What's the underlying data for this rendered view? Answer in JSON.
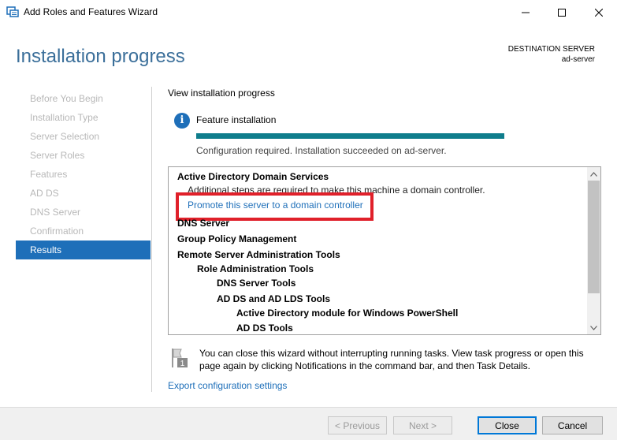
{
  "window": {
    "title": "Add Roles and Features Wizard",
    "icon": "server-manager-icon"
  },
  "header": {
    "page_title": "Installation progress",
    "destination_label": "DESTINATION SERVER",
    "destination_server": "ad-server"
  },
  "nav": {
    "items": [
      {
        "label": "Before You Begin",
        "active": false
      },
      {
        "label": "Installation Type",
        "active": false
      },
      {
        "label": "Server Selection",
        "active": false
      },
      {
        "label": "Server Roles",
        "active": false
      },
      {
        "label": "Features",
        "active": false
      },
      {
        "label": "AD DS",
        "active": false
      },
      {
        "label": "DNS Server",
        "active": false
      },
      {
        "label": "Confirmation",
        "active": false
      },
      {
        "label": "Results",
        "active": true
      }
    ]
  },
  "main": {
    "view_label": "View installation progress",
    "feature_label": "Feature installation",
    "progress": 1.0,
    "status_text": "Configuration required. Installation succeeded on ad-server.",
    "results": {
      "ad_ds_title": "Active Directory Domain Services",
      "ad_ds_note": "Additional steps are required to make this machine a domain controller.",
      "promote_link": "Promote this server to a domain controller",
      "dns_server": "DNS Server",
      "group_policy": "Group Policy Management",
      "rsat": "Remote Server Administration Tools",
      "role_admin_tools": "Role Administration Tools",
      "dns_tools": "DNS Server Tools",
      "ad_ds_lds_tools": "AD DS and AD LDS Tools",
      "ad_module_ps": "Active Directory module for Windows PowerShell",
      "ad_ds_tools": "AD DS Tools"
    },
    "notice_text": "You can close this wizard without interrupting running tasks. View task progress or open this page again by clicking Notifications in the command bar, and then Task Details.",
    "notice_badge": "1",
    "export_link": "Export configuration settings"
  },
  "footer": {
    "previous": "< Previous",
    "next": "Next >",
    "close": "Close",
    "cancel": "Cancel"
  },
  "colors": {
    "accent": "#1e6fb9",
    "progress": "#0f7d8c",
    "highlight": "#e0202a",
    "title": "#3b6f9a"
  }
}
